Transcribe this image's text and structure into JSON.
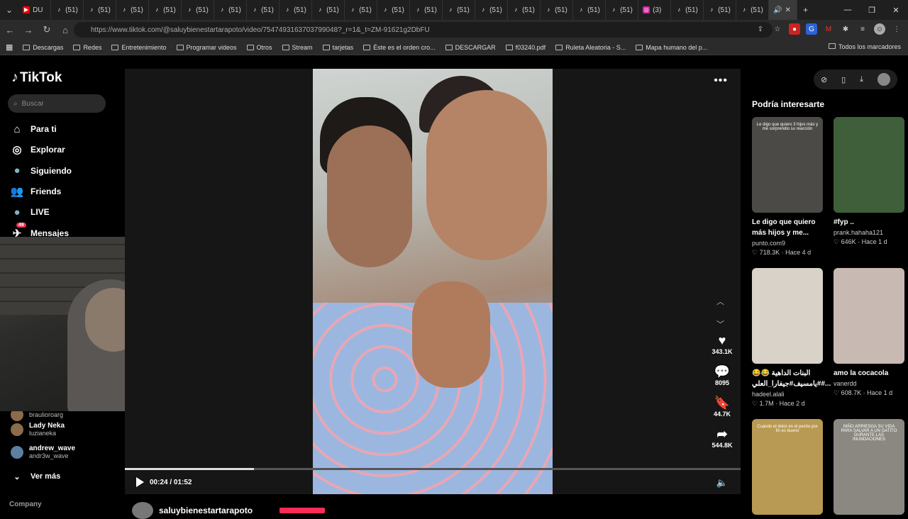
{
  "browser": {
    "tabs": [
      {
        "icon": "youtube-icon",
        "label": "DU"
      },
      {
        "icon": "tiktok-icon",
        "label": "(51)"
      },
      {
        "icon": "tiktok-icon",
        "label": "(51)"
      },
      {
        "icon": "tiktok-icon",
        "label": "(51)"
      },
      {
        "icon": "tiktok-icon",
        "label": "(51)"
      },
      {
        "icon": "tiktok-icon",
        "label": "(51)"
      },
      {
        "icon": "tiktok-icon",
        "label": "(51)"
      },
      {
        "icon": "tiktok-icon",
        "label": "(51)"
      },
      {
        "icon": "tiktok-icon",
        "label": "(51)"
      },
      {
        "icon": "tiktok-icon",
        "label": "(51)"
      },
      {
        "icon": "tiktok-icon",
        "label": "(51)"
      },
      {
        "icon": "tiktok-icon",
        "label": "(51)"
      },
      {
        "icon": "tiktok-icon",
        "label": "(51)"
      },
      {
        "icon": "tiktok-icon",
        "label": "(51)"
      },
      {
        "icon": "tiktok-icon",
        "label": "(51)"
      },
      {
        "icon": "tiktok-icon",
        "label": "(51)"
      },
      {
        "icon": "tiktok-icon",
        "label": "(51)"
      },
      {
        "icon": "tiktok-icon",
        "label": "(51)"
      },
      {
        "icon": "tiktok-icon",
        "label": "(51)"
      },
      {
        "icon": "instagram-icon",
        "label": "(3)"
      },
      {
        "icon": "tiktok-icon",
        "label": "(51)"
      },
      {
        "icon": "tiktok-icon",
        "label": "(51)"
      },
      {
        "icon": "tiktok-icon",
        "label": "(51)"
      }
    ],
    "url_host": "https://www.tiktok.com",
    "url_path": "/@saluybienestartarapoto/video/7547493163703799048?_r=1&_t=ZM-91621g2DbFU",
    "bookmarks": [
      "Descargas",
      "Redes",
      "Entretenimiento",
      "Programar videos",
      "Otros",
      "Stream",
      "tarjetas",
      "Éste es el orden cro...",
      "DESCARGAR",
      "f03240.pdf",
      "Ruleta Aleatoria - S...",
      "Mapa humano del p..."
    ],
    "all_bookmarks": "Todos los marcadores"
  },
  "sidebar": {
    "brand": "TikTok",
    "search_placeholder": "Buscar",
    "nav": [
      {
        "label": "Para ti",
        "icon": "home-icon"
      },
      {
        "label": "Explorar",
        "icon": "compass-icon"
      },
      {
        "label": "Siguiendo",
        "icon": "following-avatar-icon"
      },
      {
        "label": "Friends",
        "icon": "friends-icon"
      },
      {
        "label": "LIVE",
        "icon": "live-icon"
      },
      {
        "label": "Mensajes",
        "icon": "messages-icon",
        "badge": "49"
      }
    ],
    "following": [
      {
        "name": "",
        "handle": "braulioroarg"
      },
      {
        "name": "Lady Neka",
        "handle": "luzianeka"
      },
      {
        "name": "andrew_wave",
        "handle": "andr3w_wave"
      }
    ],
    "see_more": "Ver más",
    "company": "Company"
  },
  "player": {
    "time_current": "00:24",
    "time_total": "01:52",
    "progress": 0.21,
    "likes": "343.1K",
    "comments": "8095",
    "saves": "44.7K",
    "shares": "544.8K",
    "author": "saluybienestartarapoto"
  },
  "suggestions": {
    "title": "Podría interesarte",
    "cards": [
      {
        "title": "Le digo que quiero más hijos y me...",
        "user": "punto.com9",
        "stats": "718.3K · Hace 4 d",
        "overlay": "Le digo que quiero 3 hijos más y me sorprendio su reacción",
        "bg": "#4b4a46"
      },
      {
        "title": "#fyp ..",
        "user": "prank.hahaha121",
        "stats": "646K · Hace 1 d",
        "overlay": "",
        "bg": "#3f5f3a"
      },
      {
        "title": "البنات الداهية 😂😂 #يامسيف#جيفارا_العلي#...",
        "user": "hadeel.alali",
        "stats": "1.7M · Hace 2 d",
        "overlay": "",
        "bg": "#d8d2c8"
      },
      {
        "title": "amo la cocacola",
        "user": "vanerdd",
        "stats": "608.7K · Hace 1 d",
        "overlay": "",
        "bg": "#c9b9b3"
      },
      {
        "title": "",
        "user": "",
        "stats": "",
        "overlay": "Cuando el dolor en el pecho por fin es bueno",
        "bg": "#b89a54"
      },
      {
        "title": "",
        "user": "",
        "stats": "",
        "overlay": "NIÑO ARRIESGA SU VIDA PARA SALVAR A UN GATITO DURANTE LAS INUNDACIONES",
        "bg": "#8a8880"
      }
    ]
  }
}
